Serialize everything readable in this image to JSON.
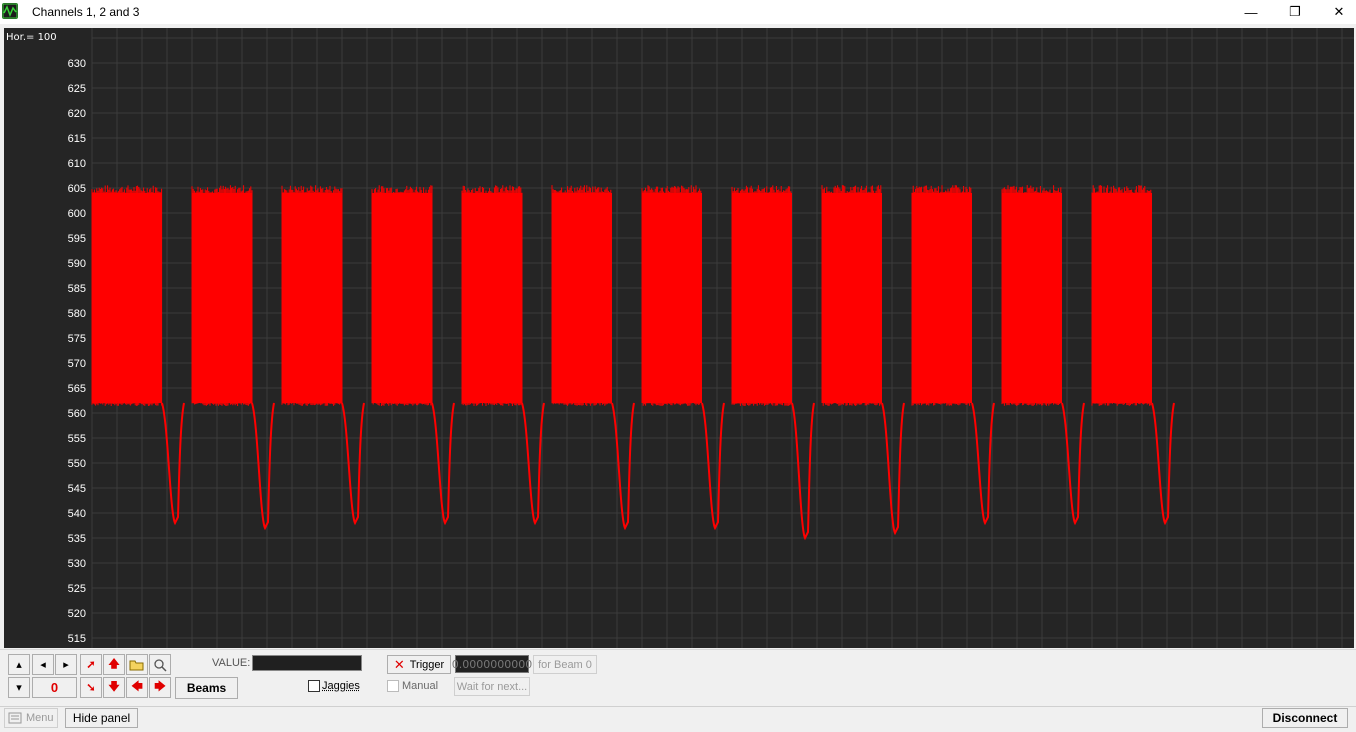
{
  "window": {
    "title": "Channels 1, 2 and 3",
    "minimize": "—",
    "restore": "❐",
    "close": "✕"
  },
  "plot": {
    "hor_label": "Hor.= 100",
    "background": "#252525",
    "grid_color": "#3c3c3c",
    "trace_color": "#ff0000",
    "y_ticks": [
      "630",
      "625",
      "620",
      "615",
      "610",
      "605",
      "600",
      "595",
      "590",
      "585",
      "580",
      "575",
      "570",
      "565",
      "560",
      "555",
      "550",
      "545",
      "540",
      "535",
      "530",
      "525",
      "520",
      "515"
    ],
    "cycles": [
      {
        "start": 0,
        "dip_min": 538,
        "band_low": 562,
        "band_high": 604
      },
      {
        "start": 1,
        "dip_min": 537,
        "band_low": 562,
        "band_high": 604
      },
      {
        "start": 2,
        "dip_min": 538,
        "band_low": 562,
        "band_high": 604
      },
      {
        "start": 3,
        "dip_min": 538,
        "band_low": 562,
        "band_high": 604
      },
      {
        "start": 4,
        "dip_min": 538,
        "band_low": 562,
        "band_high": 604
      },
      {
        "start": 5,
        "dip_min": 537,
        "band_low": 562,
        "band_high": 604
      },
      {
        "start": 6,
        "dip_min": 537,
        "band_low": 562,
        "band_high": 604
      },
      {
        "start": 7,
        "dip_min": 535,
        "band_low": 562,
        "band_high": 604
      },
      {
        "start": 8,
        "dip_min": 536,
        "band_low": 562,
        "band_high": 604
      },
      {
        "start": 9,
        "dip_min": 538,
        "band_low": 562,
        "band_high": 604
      },
      {
        "start": 10,
        "dip_min": 538,
        "band_low": 562,
        "band_high": 604
      },
      {
        "start": 11,
        "dip_min": 538,
        "band_low": 562,
        "band_high": 604
      }
    ]
  },
  "panel": {
    "counter_value": "0",
    "beams_label": "Beams",
    "value_label": "VALUE:",
    "jaggies_label": "Jaggies",
    "trigger_label": "Trigger",
    "trigger_value": "0.0000000000",
    "for_beam_label": "for Beam 0",
    "manual_label": "Manual",
    "wait_label": "Wait for next..."
  },
  "statusbar": {
    "menu_label": "Menu",
    "hide_panel_label": "Hide panel",
    "disconnect_label": "Disconnect"
  }
}
